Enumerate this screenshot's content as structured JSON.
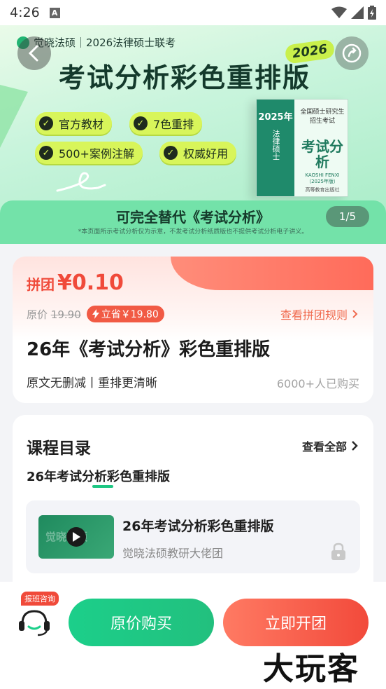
{
  "status_bar": {
    "time": "4:26",
    "notif_letter": "A"
  },
  "banner": {
    "brand": "觉晓法硕｜2026法律硕士联考",
    "title": "考试分析彩色重排版",
    "year_badge": "2026",
    "pills": [
      "官方教材",
      "7色重排",
      "500+案例注解",
      "权威好用"
    ],
    "book": {
      "year": "2025年",
      "top_text": "全国硕士研究生招生考试",
      "name": "考试分析",
      "subtitle": "KAOSHI FENXI",
      "edition": "（2025年版）",
      "spine_text": "法律硕士",
      "publisher": "高等教育出版社"
    },
    "strip_title": "可完全替代《考试分析》",
    "strip_note": "*本页面所示考试分析仅为示意，不发考试分析纸质版也不提供考试分析电子讲义。",
    "page_indicator": "1/5"
  },
  "price_card": {
    "price_label": "拼团",
    "price_value": "¥0.10",
    "orig_label": "原价",
    "orig_value": "19.90",
    "save_badge": "立省￥19.80",
    "rule_link": "查看拼团规则",
    "product_title": "26年《考试分析》彩色重排版",
    "features": "原文无删减丨重排更清晰",
    "buyers": "6000+人已购买"
  },
  "catalog": {
    "title": "课程目录",
    "see_all": "查看全部",
    "tab": "26年考试分析彩色重排版",
    "course": {
      "title": "26年考试分析彩色重排版",
      "author": "觉晓法硕教研大佬团",
      "thumb_text": "觉晓法硕"
    }
  },
  "bottom_bar": {
    "consult_tag": "报班咨询",
    "btn_original": "原价购买",
    "btn_group": "立即开团",
    "watermark": "大玩客"
  },
  "colors": {
    "brand_green": "#1ccf8a",
    "price_red": "#f04a3a",
    "pill_lime": "#d8f55a"
  }
}
